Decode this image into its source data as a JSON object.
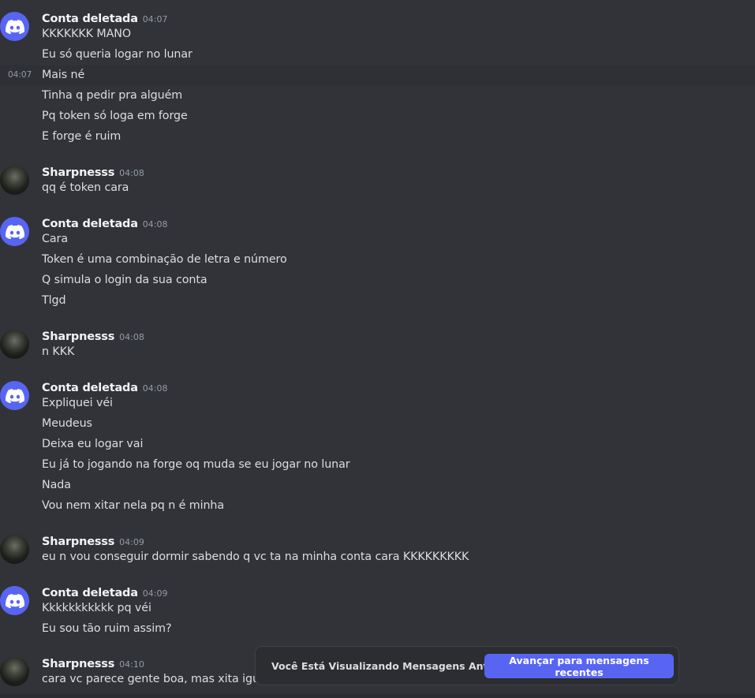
{
  "messages": {
    "g1": {
      "username": "Conta deletada",
      "time": "04:07",
      "lines": [
        "KKKKKKK MANO",
        "Eu só queria logar no lunar",
        "Mais né",
        "Tinha q pedir pra alguém",
        "Pq token só loga em forge",
        "E forge é ruim"
      ],
      "hover_time": "04:07"
    },
    "g2": {
      "username": "Sharpnesss",
      "time": "04:08",
      "lines": [
        "qq é token cara"
      ]
    },
    "g3": {
      "username": "Conta deletada",
      "time": "04:08",
      "lines": [
        "Cara",
        "Token é uma combinação de letra e número",
        "Q simula o login da sua conta",
        "Tlgd"
      ]
    },
    "g4": {
      "username": "Sharpnesss",
      "time": "04:08",
      "lines": [
        "n KKK"
      ]
    },
    "g5": {
      "username": "Conta deletada",
      "time": "04:08",
      "lines": [
        "Expliquei véi",
        "Meudeus",
        "Deixa eu logar vai",
        "Eu já to jogando na forge oq muda se eu jogar no lunar",
        "Nada",
        "Vou nem xitar nela pq n é minha"
      ]
    },
    "g6": {
      "username": "Sharpnesss",
      "time": "04:09",
      "lines": [
        "eu n vou conseguir dormir sabendo q vc ta na minha conta cara KKKKKKKKK"
      ]
    },
    "g7": {
      "username": "Conta deletada",
      "time": "04:09",
      "lines": [
        "Kkkkkkkkkkk pq véi",
        "Eu sou tão ruim assim?"
      ]
    },
    "g8": {
      "username": "Sharpnesss",
      "time": "04:10",
      "lines": [
        "cara vc parece gente boa, mas xita igual um gayslo"
      ]
    }
  },
  "banner": {
    "text": "Você Está Visualizando Mensagens Antigas",
    "button_label": "Avançar para mensagens recentes"
  },
  "colors": {
    "accent": "#5865f2",
    "background": "#313338",
    "username": "#f2f3f5",
    "timestamp": "#949ba4"
  },
  "icons": {
    "deleted_avatar": "discord-logo-icon",
    "user_avatar": "profile-photo"
  }
}
